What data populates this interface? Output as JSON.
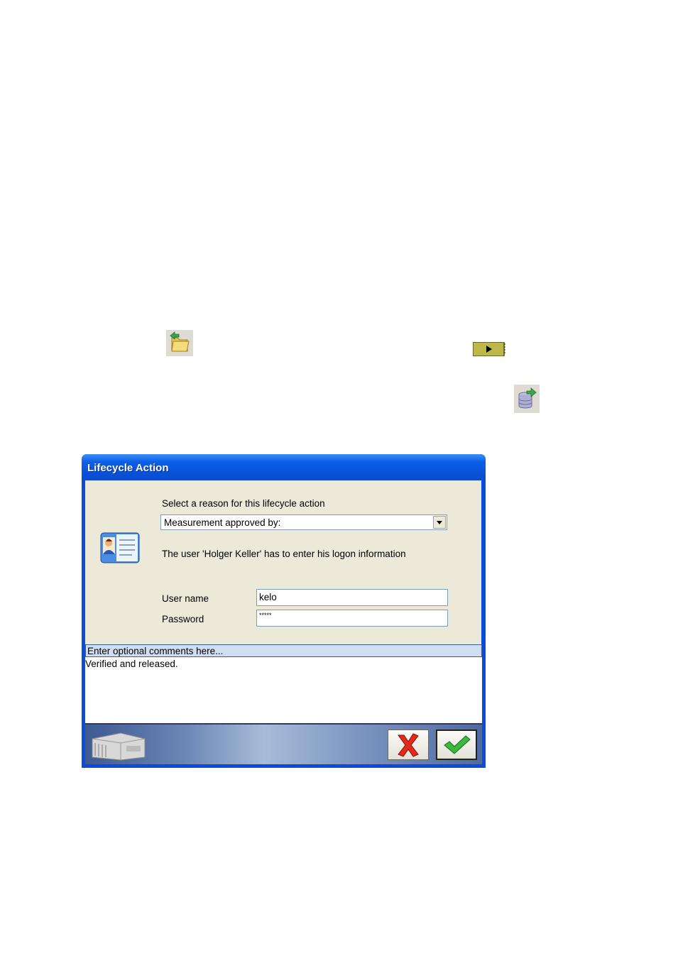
{
  "dialog": {
    "title": "Lifecycle Action",
    "reason_label": "Select a reason for this lifecycle action",
    "reason_value": "Measurement approved by:",
    "info_text": "The user 'Holger Keller' has to enter his logon information",
    "username_label": "User name",
    "username_value": "kelo",
    "password_label": "Password",
    "password_value": "*****",
    "comments_header": "Enter optional comments here...",
    "comments_text": "Verified and released."
  },
  "icons": {
    "folder": "folder-back-icon",
    "play": "play-icon",
    "export": "database-export-icon",
    "user_card": "user-card-icon",
    "server": "server-icon",
    "cancel": "red-x-icon",
    "ok": "green-check-icon"
  },
  "colors": {
    "titlebar": "#0a4cd8",
    "dialog_face": "#ece9d8",
    "comments_header": "#d1def2",
    "play_button": "#bdb84a"
  }
}
